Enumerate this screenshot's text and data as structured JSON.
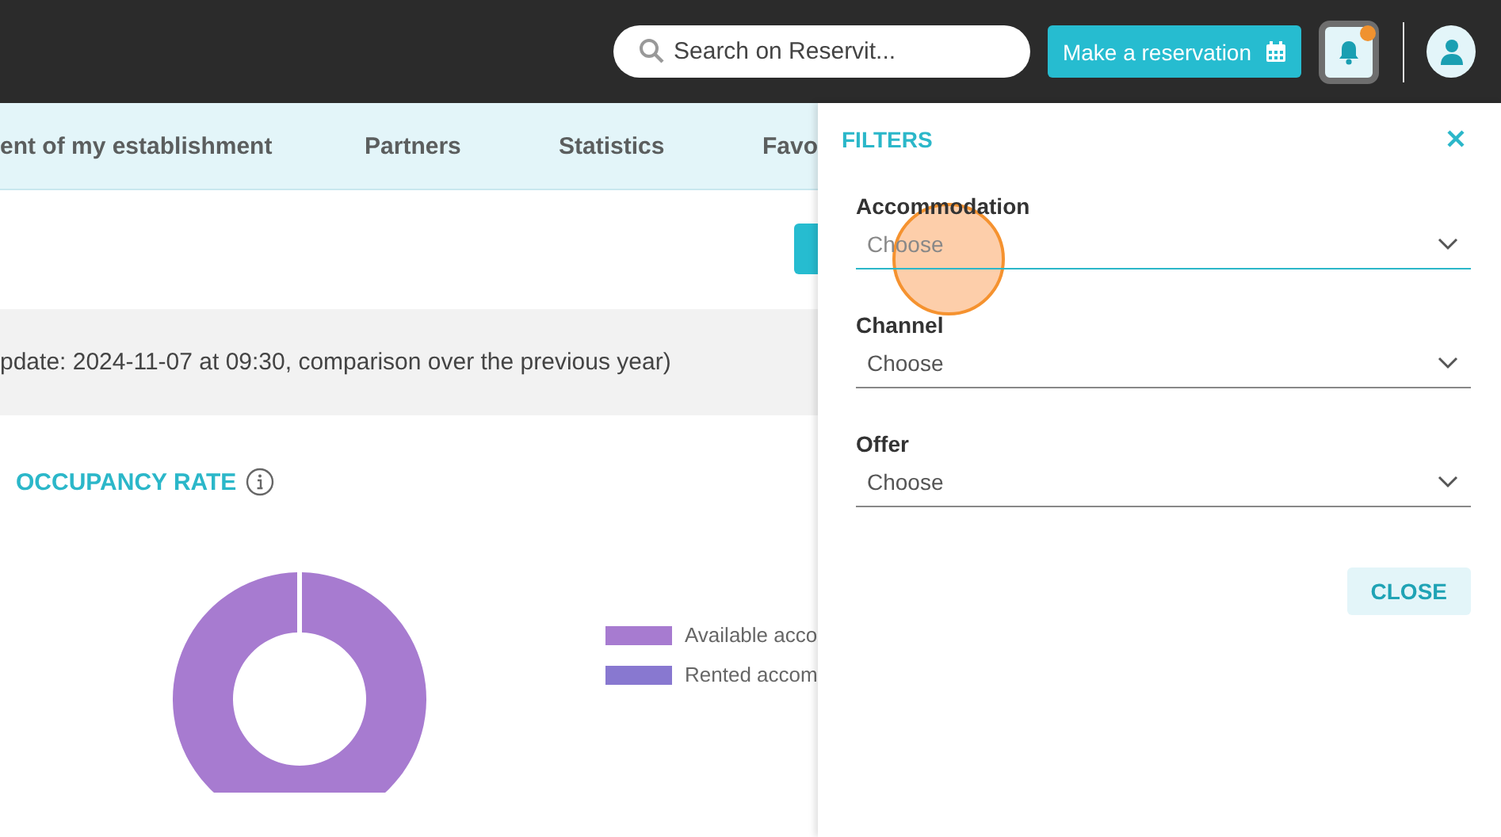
{
  "header": {
    "search": {
      "placeholder": "Search on Reservit..."
    },
    "reserve_button": "Make a reservation",
    "notifications": {
      "unread": true
    }
  },
  "nav": {
    "tabs": [
      {
        "label": "ent of my establishment"
      },
      {
        "label": "Partners"
      },
      {
        "label": "Statistics"
      },
      {
        "label": "Favo"
      }
    ]
  },
  "update_note": "pdate: 2024-11-07 at 09:30, comparison over the previous year)",
  "occupancy": {
    "title": "OCCUPANCY RATE",
    "legend": [
      {
        "label": "Available acco",
        "color": "#a77bd0"
      },
      {
        "label": "Rented accom",
        "color": "#8878d0"
      }
    ]
  },
  "filters": {
    "title": "FILTERS",
    "fields": [
      {
        "label": "Accommodation",
        "placeholder": "Choose",
        "focused": true
      },
      {
        "label": "Channel",
        "placeholder": "Choose",
        "focused": false
      },
      {
        "label": "Offer",
        "placeholder": "Choose",
        "focused": false
      }
    ],
    "close_button": "CLOSE"
  },
  "click_indicator": true
}
